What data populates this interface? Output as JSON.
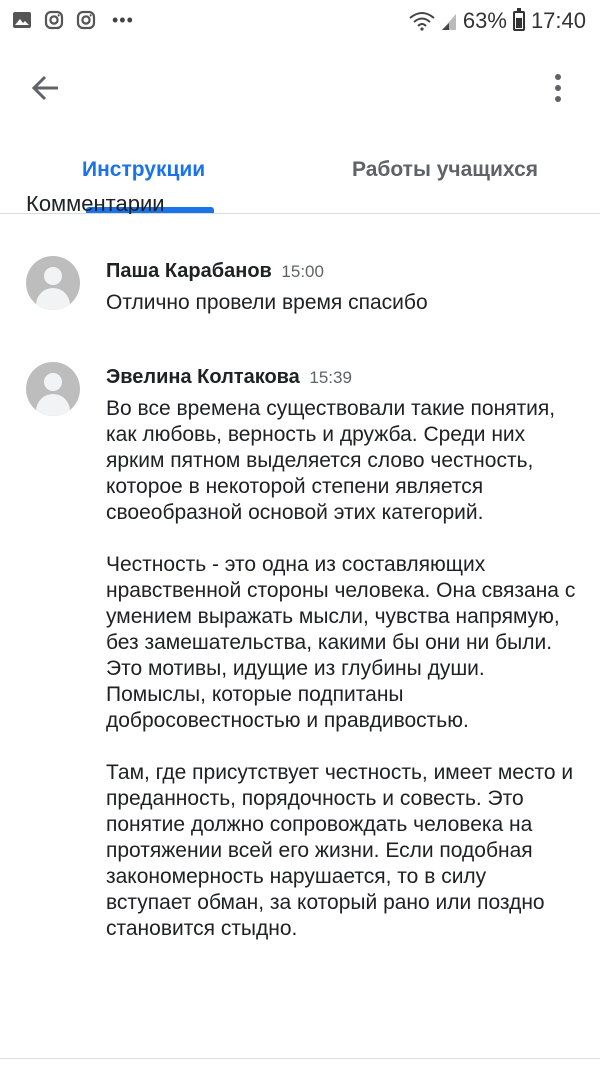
{
  "status_bar": {
    "battery": "63%",
    "time": "17:40"
  },
  "tabs": [
    {
      "label": "Инструкции",
      "active": true
    },
    {
      "label": "Работы учащихся",
      "active": false
    }
  ],
  "section_peek": "Комментарии",
  "comments": [
    {
      "author": "Паша Карабанов",
      "time": "15:00",
      "paragraphs": [
        "Отлично провели время спасибо"
      ]
    },
    {
      "author": "Эвелина Колтакова",
      "time": "15:39",
      "paragraphs": [
        "Во все времена существовали такие понятия, как любовь, верность и дружба. Среди них ярким пятном выделяется слово честность, которое в некоторой степени является своеобразной основой этих категорий.",
        "Честность - это одна из составляющих нравственной стороны человека. Она связана с умением выражать мысли, чувства напрямую, без замешательства, какими бы они ни были. Это мотивы, идущие из глубины души. Помыслы, которые подпитаны добросовестностью и правдивостью.",
        "Там, где присутствует честность, имеет место и преданность, порядочность и совесть. Это понятие должно сопровождать человека на протяжении всей его жизни. Если подобная закономерность нарушается, то в силу вступает обман, за который рано или поздно становится стыдно."
      ]
    }
  ],
  "colors": {
    "accent": "#1a73e8",
    "text": "#202124",
    "secondary": "#5f6368"
  }
}
